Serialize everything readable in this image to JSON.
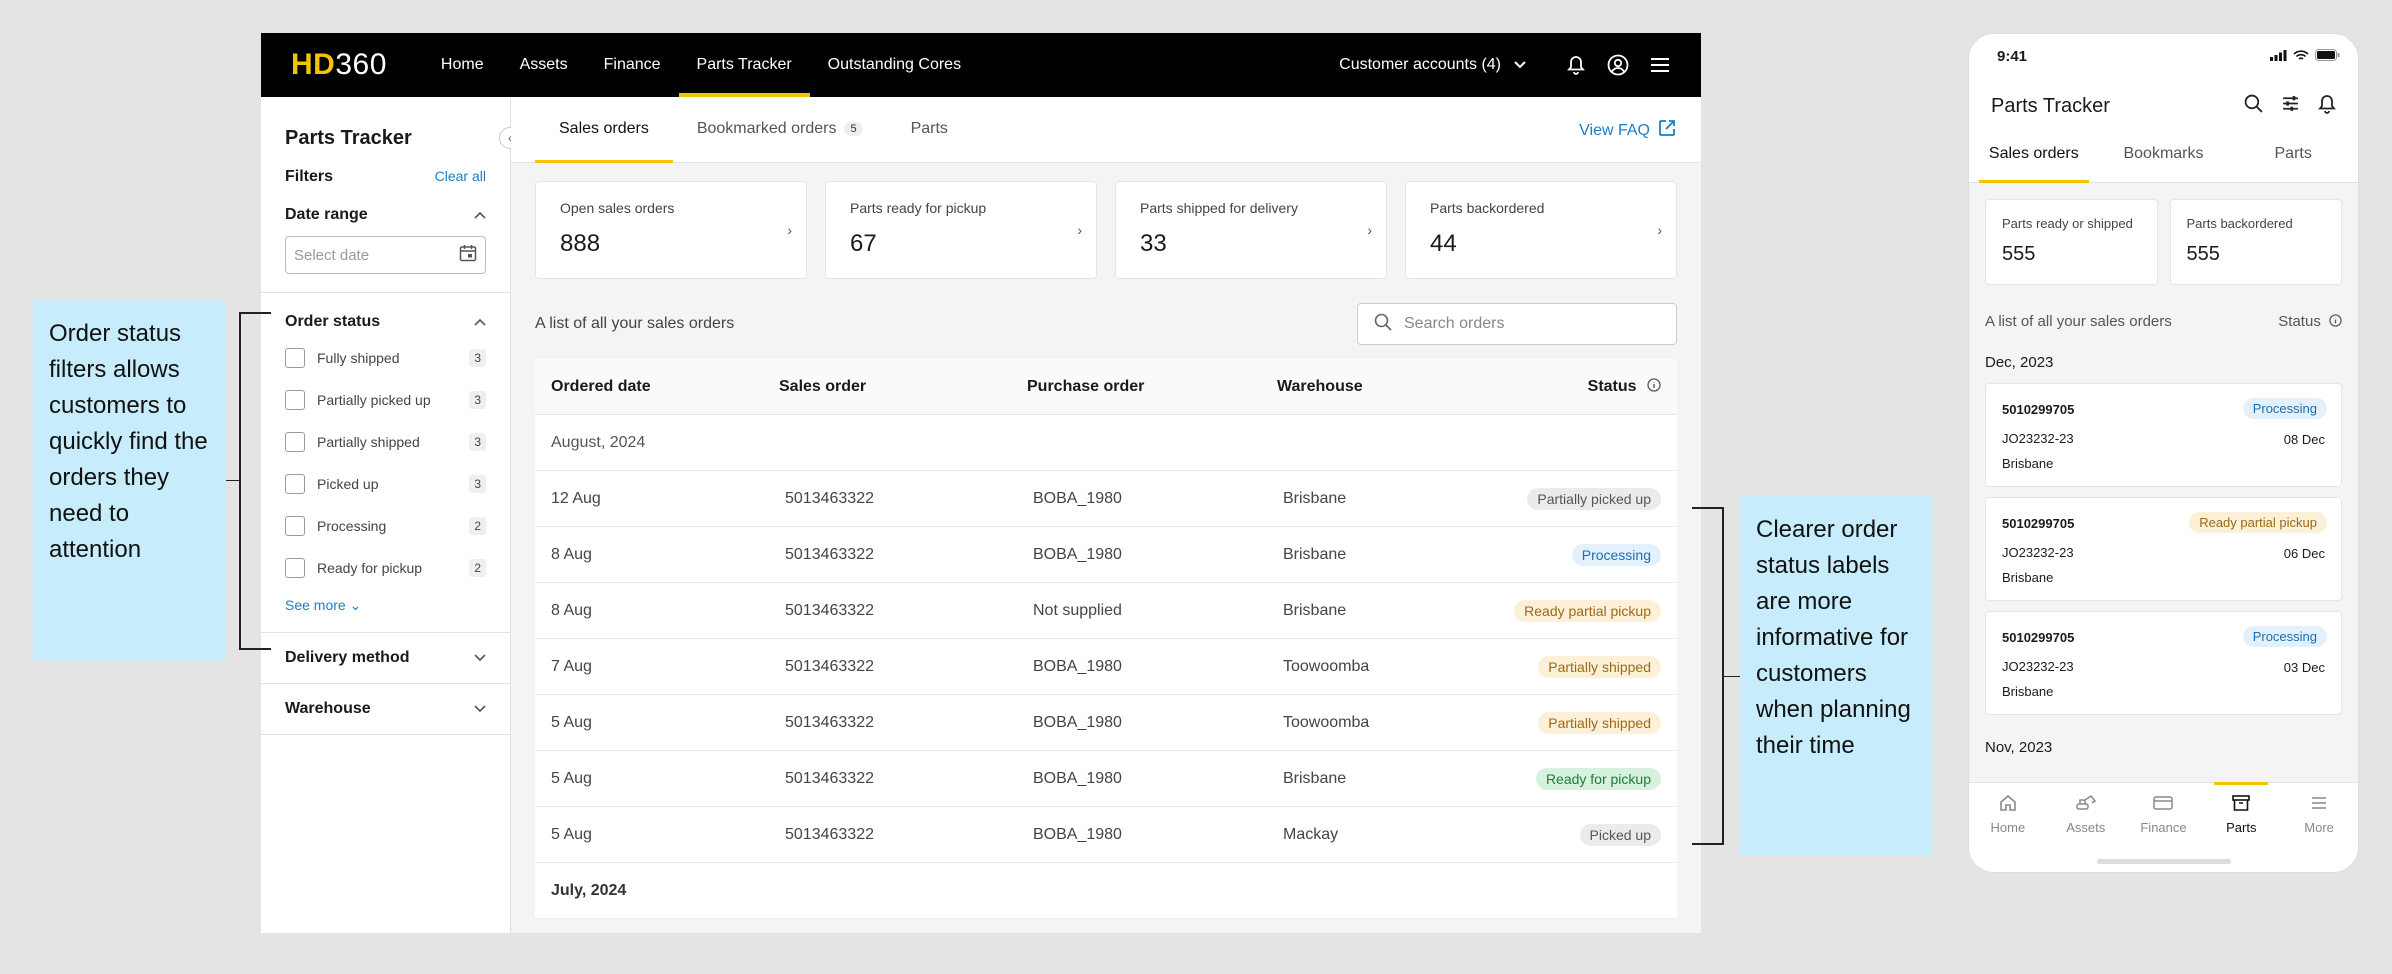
{
  "desktop": {
    "logo_hd": "HD",
    "logo_num": "360",
    "nav": [
      "Home",
      "Assets",
      "Finance",
      "Parts Tracker",
      "Outstanding Cores"
    ],
    "active_nav": "Parts Tracker",
    "accounts_label": "Customer accounts (4)",
    "sidebar": {
      "title": "Parts Tracker",
      "filters": "Filters",
      "clear_all": "Clear all",
      "date_range": "Date range",
      "date_placeholder": "Select date",
      "order_status": "Order status",
      "statuses": [
        {
          "label": "Fully shipped",
          "count": "3"
        },
        {
          "label": "Partially picked up",
          "count": "3"
        },
        {
          "label": "Partially shipped",
          "count": "3"
        },
        {
          "label": "Picked up",
          "count": "3"
        },
        {
          "label": "Processing",
          "count": "2"
        },
        {
          "label": "Ready for pickup",
          "count": "2"
        }
      ],
      "see_more": "See more",
      "delivery_method": "Delivery method",
      "warehouse": "Warehouse"
    },
    "tabs": [
      {
        "label": "Sales orders"
      },
      {
        "label": "Bookmarked orders",
        "badge": "5"
      },
      {
        "label": "Parts"
      }
    ],
    "faq": "View FAQ",
    "cards": [
      {
        "label": "Open sales orders",
        "value": "888"
      },
      {
        "label": "Parts ready for pickup",
        "value": "67"
      },
      {
        "label": "Parts shipped for delivery",
        "value": "33"
      },
      {
        "label": "Parts backordered",
        "value": "44"
      }
    ],
    "list_caption": "A list of all your sales orders",
    "search_placeholder": "Search orders",
    "columns": [
      "Ordered date",
      "Sales order",
      "Purchase order",
      "Warehouse",
      "Status"
    ],
    "group1": "August, 2024",
    "rows": [
      {
        "date": "12 Aug",
        "so": "5013463322",
        "po": "BOBA_1980",
        "wh": "Brisbane",
        "status": "Partially picked up",
        "bg": "#ebebeb",
        "fg": "#555555"
      },
      {
        "date": "8 Aug",
        "so": "5013463322",
        "po": "BOBA_1980",
        "wh": "Brisbane",
        "status": "Processing",
        "bg": "#e3f1fc",
        "fg": "#1a6fb0"
      },
      {
        "date": "8 Aug",
        "so": "5013463322",
        "po": "Not supplied",
        "wh": "Brisbane",
        "status": "Ready partial pickup",
        "bg": "#fdf0d9",
        "fg": "#9a6b14"
      },
      {
        "date": "7 Aug",
        "so": "5013463322",
        "po": "BOBA_1980",
        "wh": "Toowoomba",
        "status": "Partially shipped",
        "bg": "#fdf0d9",
        "fg": "#9a6b14"
      },
      {
        "date": "5 Aug",
        "so": "5013463322",
        "po": "BOBA_1980",
        "wh": "Toowoomba",
        "status": "Partially shipped",
        "bg": "#fdf0d9",
        "fg": "#9a6b14"
      },
      {
        "date": "5 Aug",
        "so": "5013463322",
        "po": "BOBA_1980",
        "wh": "Brisbane",
        "status": "Ready for pickup",
        "bg": "#d6f2df",
        "fg": "#1e7a3c"
      },
      {
        "date": "5 Aug",
        "so": "5013463322",
        "po": "BOBA_1980",
        "wh": "Mackay",
        "status": "Picked up",
        "bg": "#ebebeb",
        "fg": "#555555"
      }
    ],
    "group2": "July, 2024"
  },
  "annotations": {
    "left": "Order status filters allows customers to quickly find the orders they need to attention",
    "right": "Clearer order status labels are more informative for customers when planning their time"
  },
  "phone": {
    "time": "9:41",
    "title": "Parts Tracker",
    "tabs": [
      "Sales orders",
      "Bookmarks",
      "Parts"
    ],
    "cards": [
      {
        "label": "Parts ready or shipped",
        "value": "555"
      },
      {
        "label": "Parts backordered",
        "value": "555"
      }
    ],
    "list_caption": "A list of all your sales orders",
    "status_label": "Status",
    "month1": "Dec, 2023",
    "orders": [
      {
        "so": "5010299705",
        "jo": "JO23232-23",
        "date": "08 Dec",
        "wh": "Brisbane",
        "status": "Processing",
        "bg": "#e3f1fc",
        "fg": "#1a6fb0"
      },
      {
        "so": "5010299705",
        "jo": "JO23232-23",
        "date": "06 Dec",
        "wh": "Brisbane",
        "status": "Ready partial pickup",
        "bg": "#fdf0d9",
        "fg": "#9a6b14"
      },
      {
        "so": "5010299705",
        "jo": "JO23232-23",
        "date": "03 Dec",
        "wh": "Brisbane",
        "status": "Processing",
        "bg": "#e3f1fc",
        "fg": "#1a6fb0"
      }
    ],
    "month2": "Nov, 2023",
    "bottom_nav": [
      "Home",
      "Assets",
      "Finance",
      "Parts",
      "More"
    ]
  }
}
